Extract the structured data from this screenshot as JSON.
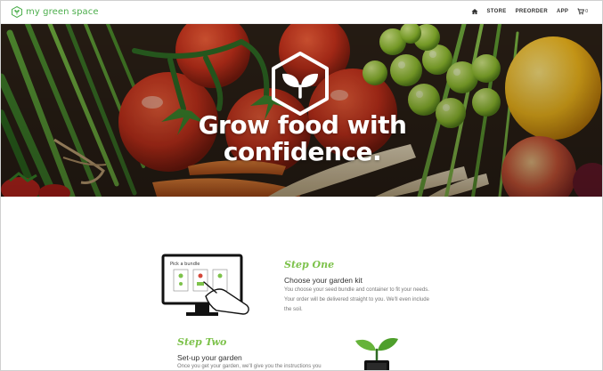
{
  "brand": {
    "name": "my green space"
  },
  "nav": {
    "items": [
      {
        "label": "STORE"
      },
      {
        "label": "PREORDER"
      },
      {
        "label": "APP"
      }
    ],
    "cart_count": "0"
  },
  "hero": {
    "title_line1": "Grow food with",
    "title_line2": "confidence."
  },
  "illustration": {
    "screen_label": "Pick a bundle"
  },
  "steps": [
    {
      "heading": "Step One",
      "subtitle": "Choose your garden kit",
      "body_line1": "You choose your seed bundle and container to fit your needs.",
      "body_line2": "Your order will be delivered straight to you. We'll even include",
      "body_line3": "the soil."
    },
    {
      "heading": "Step Two",
      "subtitle": "Set-up your garden",
      "body_line1": "Once you get your garden, we'll give you the instructions you"
    }
  ],
  "colors": {
    "brand_green": "#4cae4c",
    "step_green": "#7dc24b",
    "hero_text": "#ffffff"
  },
  "icons": {
    "logo": "leaf-hexagon-icon",
    "home": "home-icon",
    "cart": "cart-icon",
    "emblem": "sprout-hexagon-icon"
  }
}
